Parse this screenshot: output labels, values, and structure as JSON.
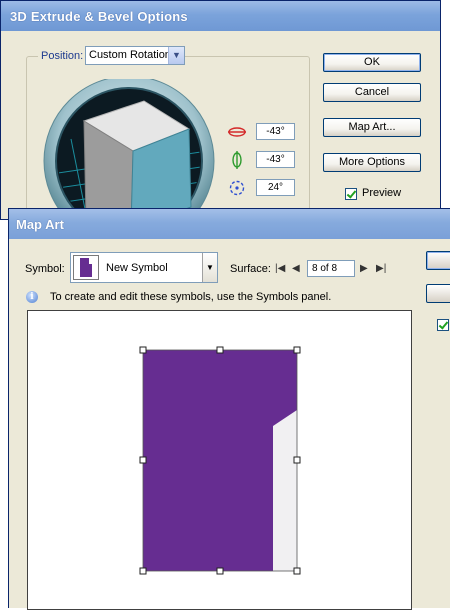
{
  "extrude_dialog": {
    "title": "3D Extrude & Bevel Options",
    "position_label": "Position:",
    "position_value": "Custom Rotation",
    "rotation": {
      "x": "-43°",
      "y": "-43°",
      "z": "24°"
    },
    "buttons": {
      "ok": "OK",
      "cancel": "Cancel",
      "map_art": "Map Art...",
      "more_options": "More Options"
    },
    "preview_label": "Preview",
    "preview_checked": true
  },
  "map_art_dialog": {
    "title": "Map Art",
    "symbol_label": "Symbol:",
    "symbol_value": "New Symbol",
    "surface_label": "Surface:",
    "surface_value": "8 of 8",
    "nav_icons": [
      "first-surface-icon",
      "prev-surface-icon",
      "next-surface-icon",
      "last-surface-icon"
    ],
    "info_text": "To create and edit these symbols, use the Symbols panel.",
    "right_checkbox_checked": true
  },
  "colors": {
    "symbol_purple": "#662d91",
    "surface_grey": "#f1f0f2",
    "titlebar_blue": "#7ba3db",
    "cube_cyan": "#5ba3b8"
  }
}
